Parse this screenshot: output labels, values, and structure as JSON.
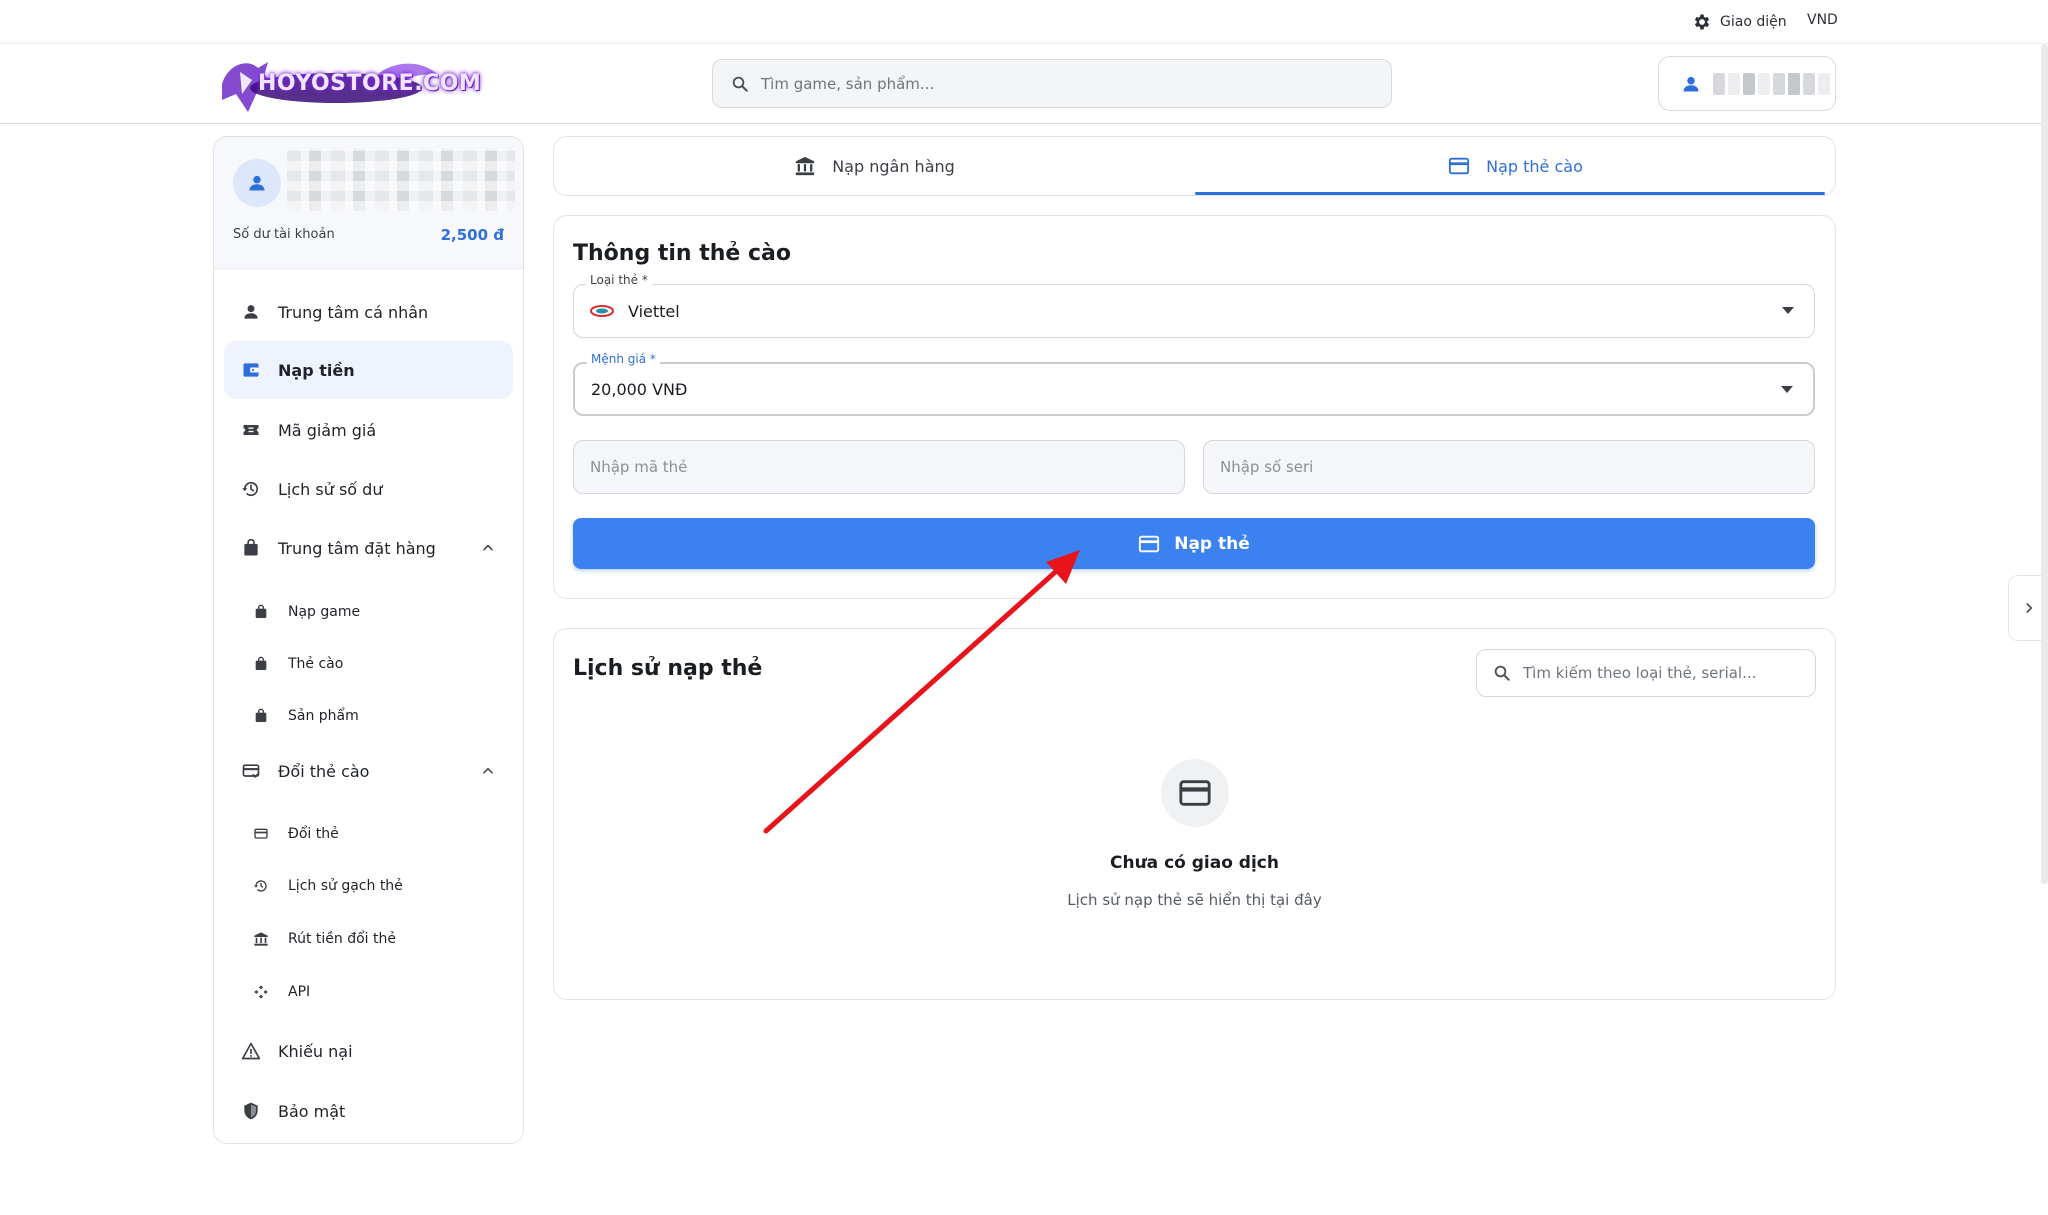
{
  "topbar": {
    "theme_label": "Giao diện",
    "currency": "VND"
  },
  "header": {
    "logo_text": "HOYOSTORE.COM",
    "search_placeholder": "Tìm game, sản phẩm..."
  },
  "sidebar": {
    "balance_label": "Số dư tài khoản",
    "balance_value": "2,500 đ",
    "items": [
      {
        "label": "Trung tâm cá nhân",
        "icon": "person-icon"
      },
      {
        "label": "Nạp tiền",
        "icon": "wallet-icon",
        "active": true
      },
      {
        "label": "Mã giảm giá",
        "icon": "ticket-icon"
      },
      {
        "label": "Lịch sử số dư",
        "icon": "history-icon"
      },
      {
        "label": "Trung tâm đặt hàng",
        "icon": "bag-icon",
        "expanded": true
      },
      {
        "label": "Đổi thẻ cào",
        "icon": "card-exchange-icon",
        "expanded": true
      },
      {
        "label": "Khiếu nại",
        "icon": "warning-icon"
      },
      {
        "label": "Bảo mật",
        "icon": "shield-icon"
      }
    ],
    "order_sub": [
      {
        "label": "Nạp game",
        "icon": "bag-icon"
      },
      {
        "label": "Thẻ cào",
        "icon": "bag-icon"
      },
      {
        "label": "Sản phẩm",
        "icon": "bag-icon"
      }
    ],
    "exchange_sub": [
      {
        "label": "Đổi thẻ",
        "icon": "card-exchange-icon"
      },
      {
        "label": "Lịch sử gạch thẻ",
        "icon": "history-icon"
      },
      {
        "label": "Rút tiền đổi thẻ",
        "icon": "bank-icon"
      },
      {
        "label": "API",
        "icon": "api-icon"
      }
    ]
  },
  "tabs": [
    {
      "label": "Nạp ngân hàng",
      "icon": "bank-icon"
    },
    {
      "label": "Nạp thẻ cào",
      "icon": "credit-card-icon",
      "active": true
    }
  ],
  "card_form": {
    "title": "Thông tin thẻ cào",
    "card_type_label": "Loại thẻ *",
    "card_type_value": "Viettel",
    "amount_label": "Mệnh giá *",
    "amount_value": "20,000 VNĐ",
    "code_placeholder": "Nhập mã thẻ",
    "serial_placeholder": "Nhập số seri",
    "submit_label": "Nạp thẻ"
  },
  "history": {
    "title": "Lịch sử nạp thẻ",
    "search_placeholder": "Tìm kiếm theo loại thẻ, serial...",
    "empty_title": "Chưa có giao dịch",
    "empty_subtitle": "Lịch sử nạp thẻ sẽ hiển thị tại đây"
  },
  "colors": {
    "accent": "#2e6fdb",
    "button": "#3b82f0",
    "annotation_arrow": "#e8141b"
  }
}
